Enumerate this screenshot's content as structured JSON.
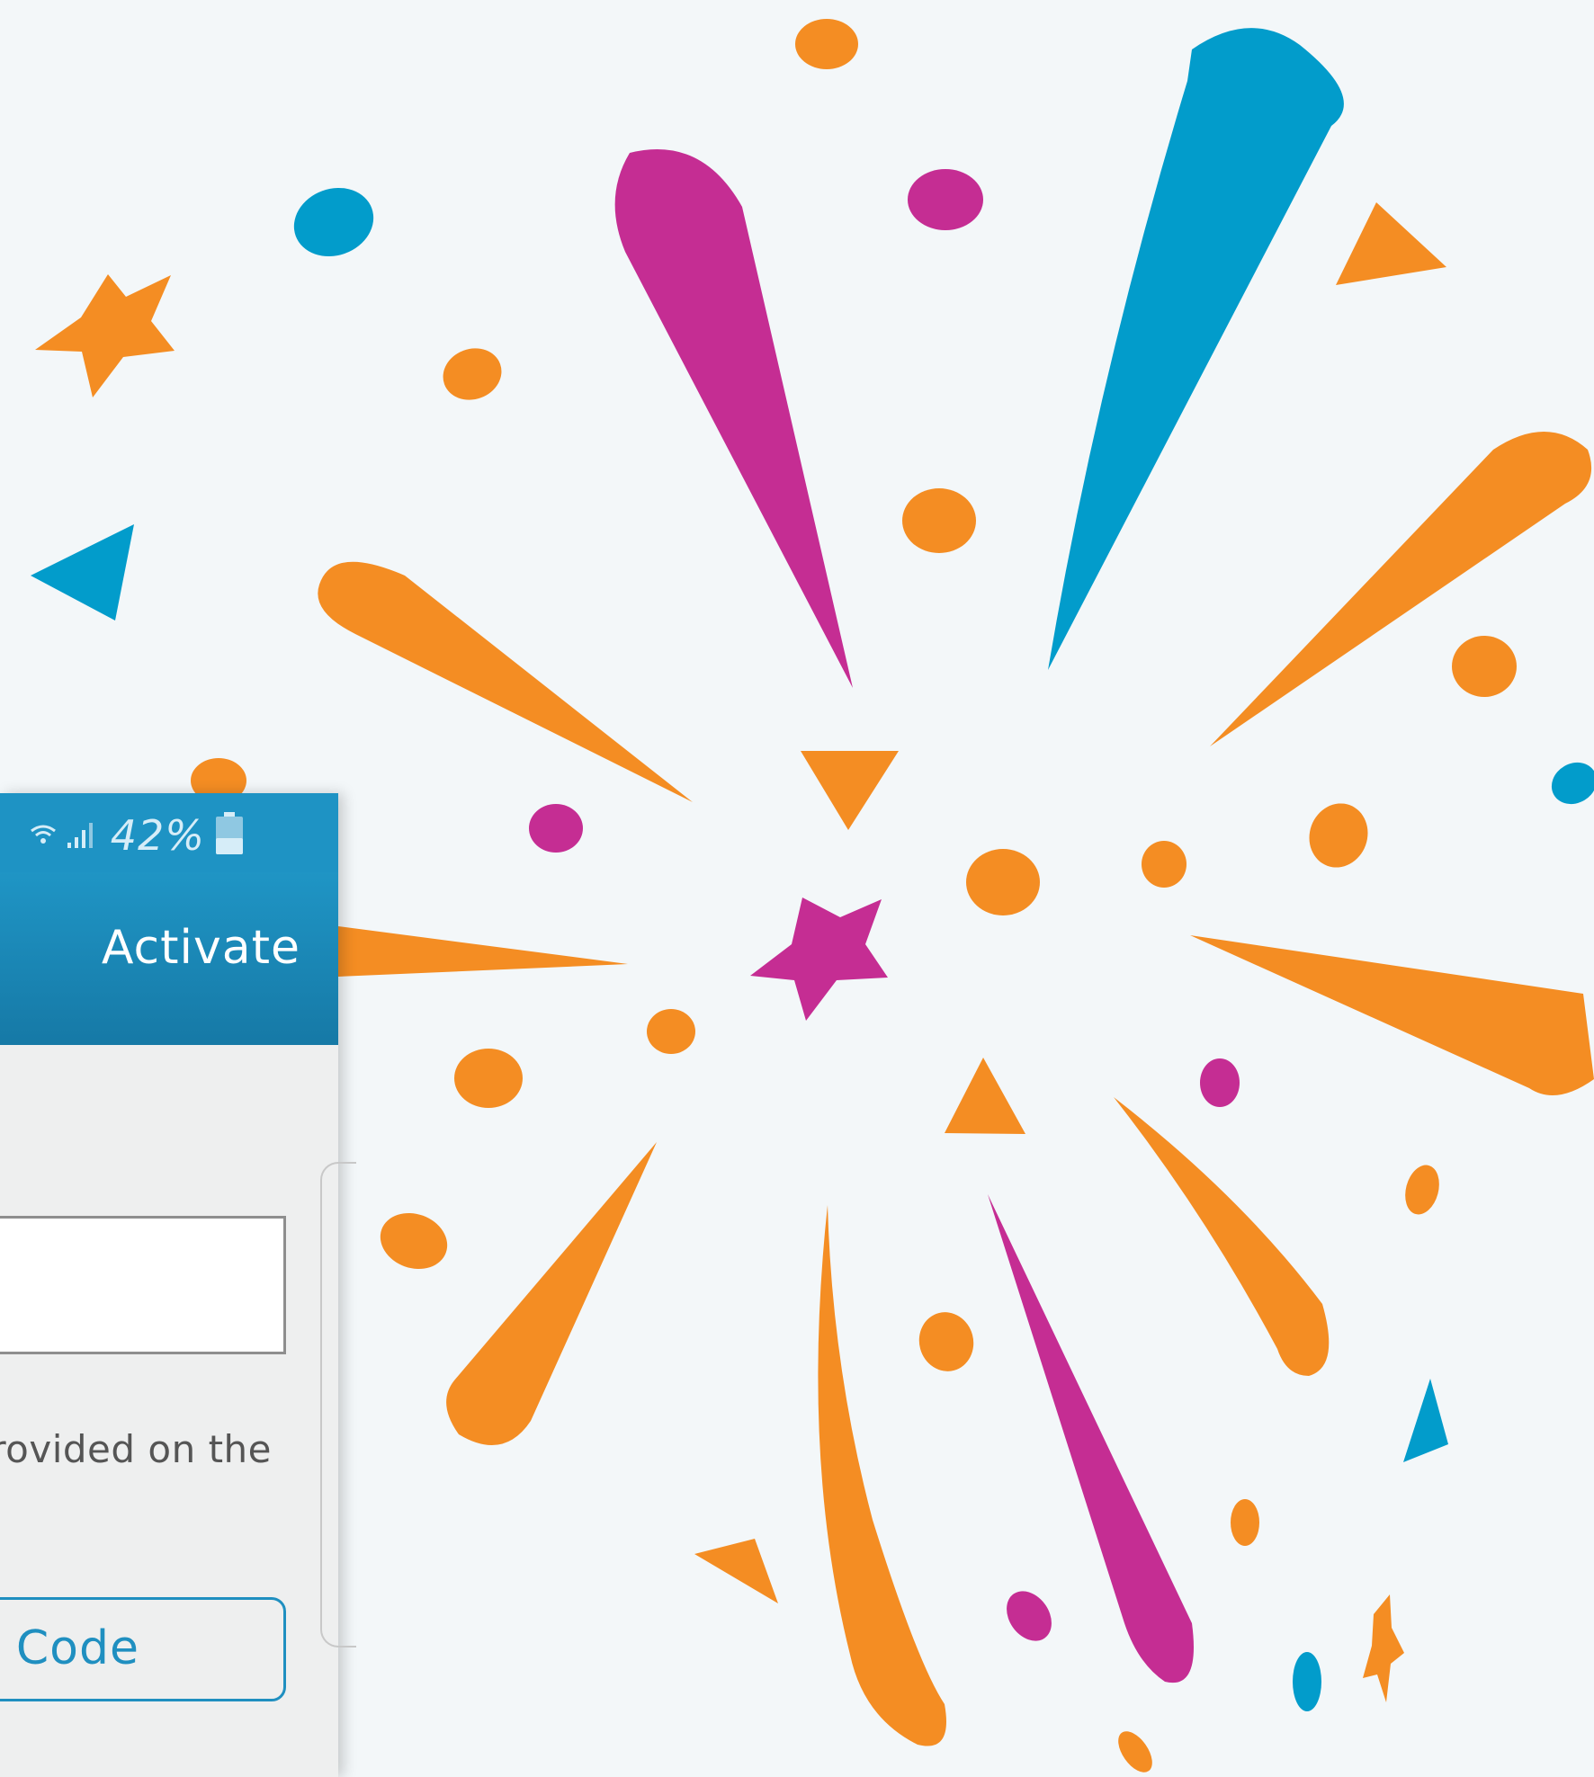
{
  "status_bar": {
    "battery_percent": "42%",
    "wifi_icon": "wifi-icon",
    "signal_icon": "signal-bars-icon",
    "battery_icon": "battery-icon"
  },
  "app_bar": {
    "action_label": "Activate"
  },
  "form": {
    "code_input_value": "",
    "help_text": "rovided on the",
    "button_label": "n Code"
  },
  "colors": {
    "background": "#f3f7f9",
    "orange": "#f48d23",
    "magenta": "#c52d93",
    "blue": "#029ccb",
    "app_bar": "#1e93c4"
  }
}
